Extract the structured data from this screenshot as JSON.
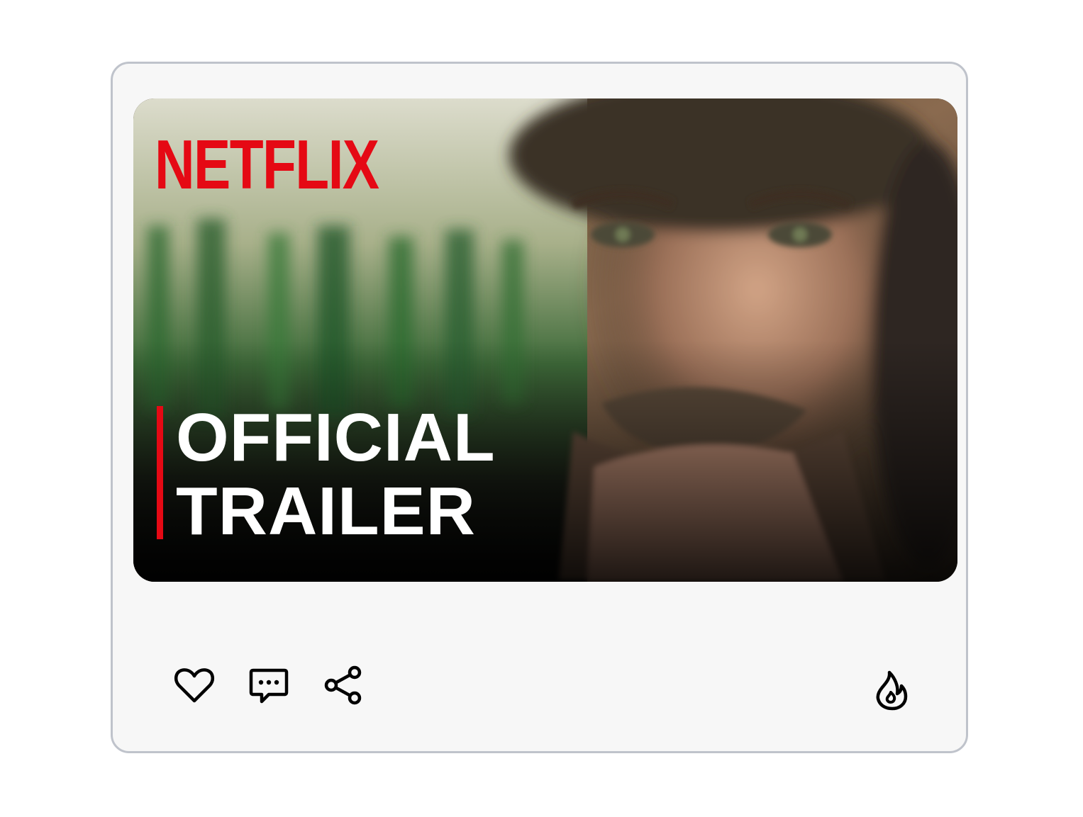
{
  "video": {
    "brand_logo_text": "NETFLIX",
    "headline_line1": "OFFICIAL",
    "headline_line2": "TRAILER"
  },
  "actions": {
    "like_icon": "heart-icon",
    "comment_icon": "comment-icon",
    "share_icon": "share-icon",
    "trending_icon": "flame-icon"
  },
  "colors": {
    "brand_red": "#e50914",
    "card_background": "#f7f7f7",
    "card_border": "#bfc3cb"
  }
}
